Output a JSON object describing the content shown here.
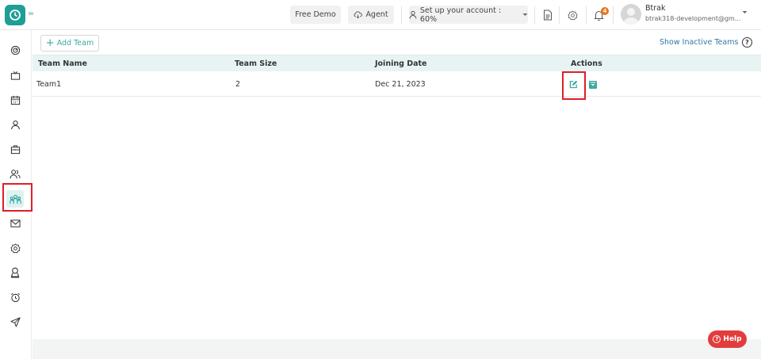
{
  "topbar": {
    "expand_glyph": "›››",
    "free_demo": "Free Demo",
    "agent": "Agent",
    "setup": "Set up your account : 60%",
    "notification_count": "4",
    "user_name": "Btrak",
    "user_email": "btrak318-development@gm..."
  },
  "sidebar": {
    "items": [
      "dashboard-icon",
      "tv-icon",
      "calendar-icon",
      "user-icon",
      "briefcase-icon",
      "users-icon",
      "teams-icon",
      "mail-icon",
      "settings-icon",
      "award-icon",
      "alarm-icon",
      "send-icon"
    ],
    "active_item": "teams-icon"
  },
  "toolbar": {
    "add_team": "Add Team",
    "show_inactive": "Show Inactive Teams"
  },
  "table": {
    "columns": [
      "Team Name",
      "Team Size",
      "Joining Date",
      "Actions"
    ],
    "rows": [
      {
        "team_name": "Team1",
        "team_size": "2",
        "joining_date": "Dec 21, 2023"
      }
    ]
  },
  "help": {
    "label": "Help"
  },
  "colors": {
    "accent": "#1e9e96",
    "highlight": "#e01f26",
    "header_bg": "#e8f4f3",
    "help": "#e23d3d"
  }
}
